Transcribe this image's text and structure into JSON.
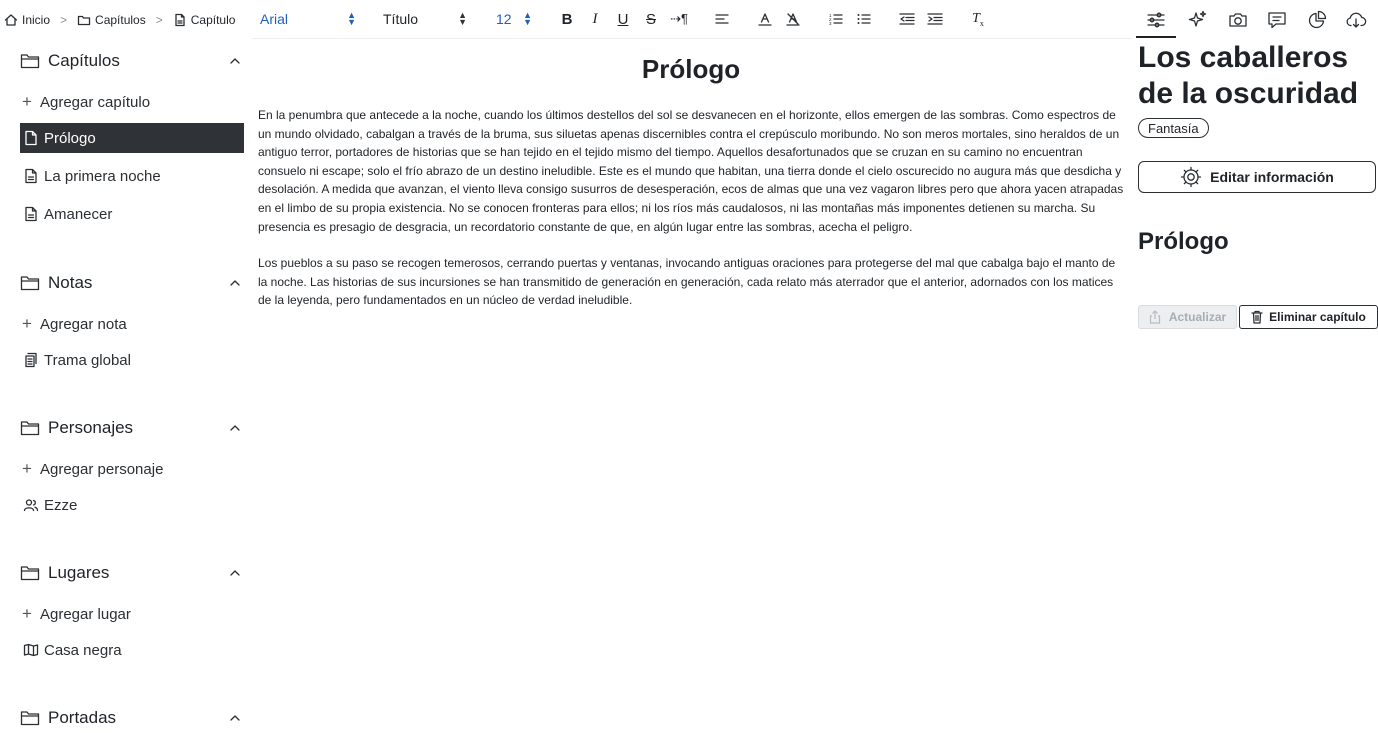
{
  "breadcrumb": {
    "items": [
      {
        "label": "Inicio",
        "icon": "home-icon"
      },
      {
        "label": "Capítulos",
        "icon": "folder-icon"
      },
      {
        "label": "Capítulo",
        "icon": "document-icon"
      }
    ],
    "separator": ">"
  },
  "toolbar": {
    "font_family": "Arial",
    "block_style": "Título",
    "font_size": "12",
    "accent_color": "#1f5fbf",
    "buttons": [
      "bold-icon",
      "italic-icon",
      "underline-icon",
      "strikethrough-icon",
      "paragraph-direction-icon",
      "align-icon",
      "font-color-icon",
      "highlight-icon",
      "ordered-list-icon",
      "bullet-list-icon",
      "outdent-icon",
      "indent-icon",
      "clear-format-icon"
    ]
  },
  "right_toolbar": {
    "buttons": [
      "settings-sliders-icon",
      "sparkles-icon",
      "camera-icon",
      "comment-icon",
      "pie-chart-icon",
      "cloud-download-icon"
    ],
    "active": "settings-sliders-icon"
  },
  "sidebar": {
    "sections": [
      {
        "title": "Capítulos",
        "add_label": "Agregar capítulo",
        "items": [
          {
            "label": "Prólogo",
            "icon": "document-icon",
            "selected": true
          },
          {
            "label": "La primera noche",
            "icon": "document-icon"
          },
          {
            "label": "Amanecer",
            "icon": "document-icon"
          }
        ]
      },
      {
        "title": "Notas",
        "add_label": "Agregar nota",
        "items": [
          {
            "label": "Trama global",
            "icon": "notes-stack-icon"
          }
        ]
      },
      {
        "title": "Personajes",
        "add_label": "Agregar personaje",
        "items": [
          {
            "label": "Ezze",
            "icon": "users-icon"
          }
        ]
      },
      {
        "title": "Lugares",
        "add_label": "Agregar lugar",
        "items": [
          {
            "label": "Casa negra",
            "icon": "map-icon"
          }
        ]
      },
      {
        "title": "Portadas",
        "add_label": "",
        "items": []
      }
    ]
  },
  "editor": {
    "title": "Prólogo",
    "paragraphs": [
      "En la penumbra que antecede a la noche, cuando los últimos destellos del sol se desvanecen en el horizonte, ellos emergen de las sombras. Como espectros de un mundo olvidado, cabalgan a través de la bruma, sus siluetas apenas discernibles contra el crepúsculo moribundo. No son meros mortales, sino heraldos de un antiguo terror, portadores de historias que se han tejido en el tejido mismo del tiempo. Aquellos desafortunados que se cruzan en su camino no encuentran consuelo ni escape; solo el frío abrazo de un destino ineludible. Este es el mundo que habitan, una tierra donde el cielo oscurecido no augura más que desdicha y desolación. A medida que avanzan, el viento lleva consigo susurros de desesperación, ecos de almas que una vez vagaron libres pero que ahora yacen atrapadas en el limbo de su propia existencia. No se conocen fronteras para ellos; ni los ríos más caudalosos, ni las montañas más imponentes detienen su marcha. Su presencia es presagio de desgracia, un recordatorio constante de que, en algún lugar entre las sombras, acecha el peligro.",
      "Los pueblos a su paso se recogen temerosos, cerrando puertas y ventanas, invocando antiguas oraciones para protegerse del mal que cabalga bajo el manto de la noche. Las historias de sus incursiones se han transmitido de generación en generación, cada relato más aterrador que el anterior, adornados con los matices de la leyenda, pero fundamentados en un núcleo de verdad ineludible."
    ]
  },
  "right_panel": {
    "book_title": "Los caballeros de la oscuridad",
    "genre": "Fantasía",
    "edit_label": "Editar información",
    "chapter_title": "Prólogo",
    "update_label": "Actualizar",
    "delete_label": "Eliminar capítulo"
  }
}
